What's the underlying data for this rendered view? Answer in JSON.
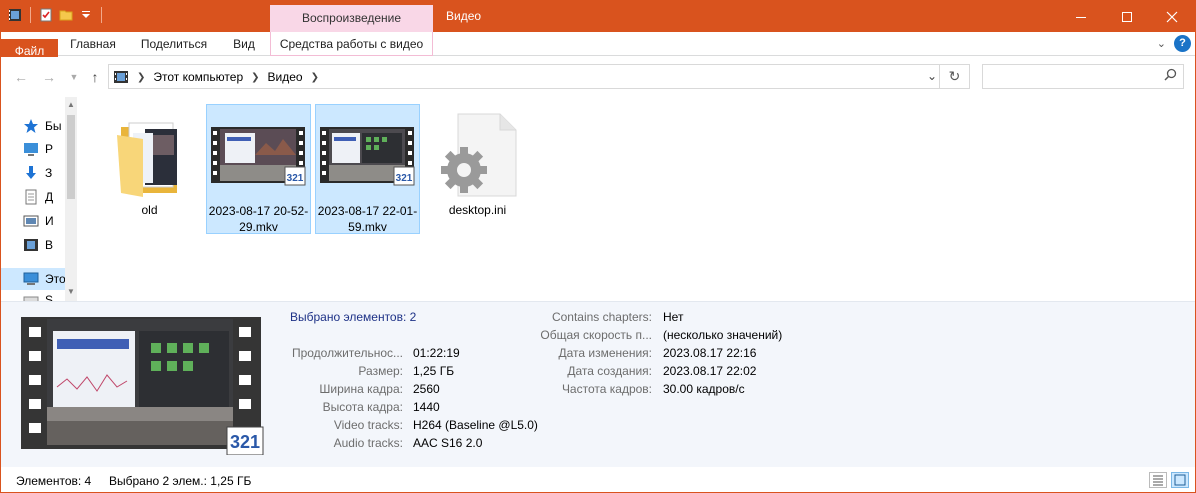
{
  "window": {
    "context_tab_header": "Воспроизведение",
    "title": "Видео"
  },
  "ribbon": {
    "tabs": [
      {
        "label": "Файл"
      },
      {
        "label": "Главная"
      },
      {
        "label": "Поделиться"
      },
      {
        "label": "Вид"
      },
      {
        "label": "Средства работы с видео"
      }
    ]
  },
  "address": {
    "crumbs": [
      "Этот компьютер",
      "Видео"
    ],
    "search_placeholder": ""
  },
  "navpane": {
    "items": [
      {
        "label": "Бы",
        "icon": "star-icon"
      },
      {
        "label": "Р",
        "icon": "desktop-icon"
      },
      {
        "label": "З",
        "icon": "download-icon"
      },
      {
        "label": "Д",
        "icon": "document-icon"
      },
      {
        "label": "И",
        "icon": "pictures-icon"
      },
      {
        "label": "В",
        "icon": "video-icon"
      },
      {
        "label": "Это",
        "icon": "computer-icon"
      },
      {
        "label": "S",
        "icon": "drive-icon"
      }
    ]
  },
  "files": [
    {
      "name": "old",
      "type": "folder"
    },
    {
      "name": "2023-08-17 20-52-29.mkv",
      "type": "video",
      "selected": true
    },
    {
      "name": "2023-08-17 22-01-59.mkv",
      "type": "video",
      "selected": true
    },
    {
      "name": "desktop.ini",
      "type": "settings"
    }
  ],
  "details": {
    "selection_text": "Выбрано элементов: 2",
    "left": [
      {
        "label": "Продолжительнос...",
        "value": "01:22:19"
      },
      {
        "label": "Размер:",
        "value": "1,25 ГБ"
      },
      {
        "label": "Ширина кадра:",
        "value": "2560"
      },
      {
        "label": "Высота кадра:",
        "value": "1440"
      },
      {
        "label": "Video tracks:",
        "value": "H264 (Baseline @L5.0)"
      },
      {
        "label": "Audio tracks:",
        "value": "AAC S16 2.0"
      }
    ],
    "right": [
      {
        "label": "Contains chapters:",
        "value": "Нет"
      },
      {
        "label": "Общая скорость п...",
        "value": "(несколько значений)"
      },
      {
        "label": "Дата изменения:",
        "value": "2023.08.17 22:16"
      },
      {
        "label": "Дата создания:",
        "value": "2023.08.17 22:02"
      },
      {
        "label": "Частота кадров:",
        "value": "30.00 кадров/с"
      }
    ]
  },
  "status": {
    "count": "Элементов: 4",
    "selected": "Выбрано 2 элем.: 1,25 ГБ"
  },
  "colors": {
    "accent": "#d9531e",
    "context_tab": "#f9d7e7",
    "selection": "#cce8ff",
    "details_bg": "#f3f6fb"
  }
}
